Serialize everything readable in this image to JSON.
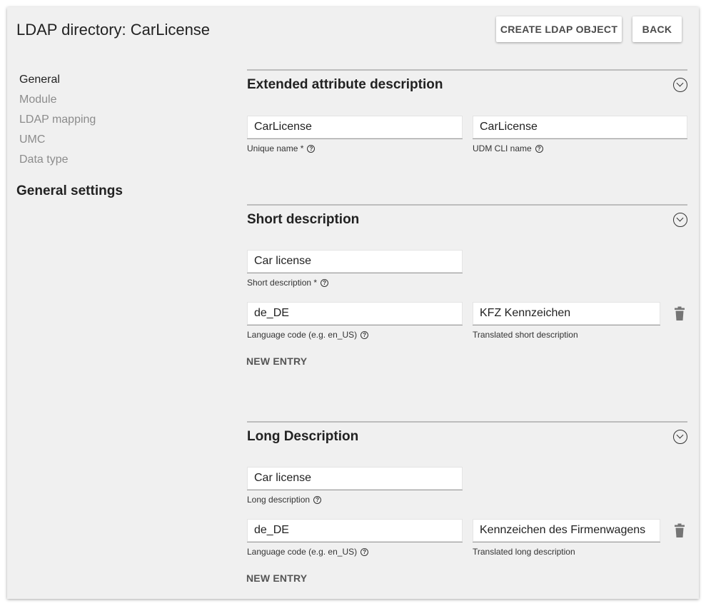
{
  "header": {
    "title": "LDAP directory: CarLicense",
    "create_label": "CREATE LDAP OBJECT",
    "back_label": "BACK"
  },
  "sidenav": {
    "items": [
      {
        "label": "General",
        "active": true
      },
      {
        "label": "Module",
        "active": false
      },
      {
        "label": "LDAP mapping",
        "active": false
      },
      {
        "label": "UMC",
        "active": false
      },
      {
        "label": "Data type",
        "active": false
      }
    ],
    "heading": "General settings"
  },
  "sections": {
    "extended": {
      "title": "Extended attribute description",
      "unique_name": {
        "value": "CarLicense",
        "label": "Unique name *"
      },
      "udm_cli_name": {
        "value": "CarLicense",
        "label": "UDM CLI name"
      }
    },
    "short": {
      "title": "Short description",
      "description": {
        "value": "Car license",
        "label": "Short description *"
      },
      "translation": {
        "lang_value": "de_DE",
        "lang_label": "Language code (e.g. en_US)",
        "text_value": "KFZ Kennzeichen",
        "text_label": "Translated short description"
      },
      "new_entry_label": "NEW ENTRY"
    },
    "long": {
      "title": "Long Description",
      "description": {
        "value": "Car license",
        "label": "Long description"
      },
      "translation": {
        "lang_value": "de_DE",
        "lang_label": "Language code (e.g. en_US)",
        "text_value": "Kennzeichen des Firmenwagens",
        "text_label": "Translated long description"
      },
      "new_entry_label": "NEW ENTRY"
    }
  },
  "icons": {
    "help": "help-circle-icon",
    "collapse": "chevron-circle-down-icon",
    "delete": "trash-icon"
  },
  "colors": {
    "background": "#f0f0f0",
    "divider": "#bdbdbd",
    "nav_inactive": "#8c8c8c"
  }
}
